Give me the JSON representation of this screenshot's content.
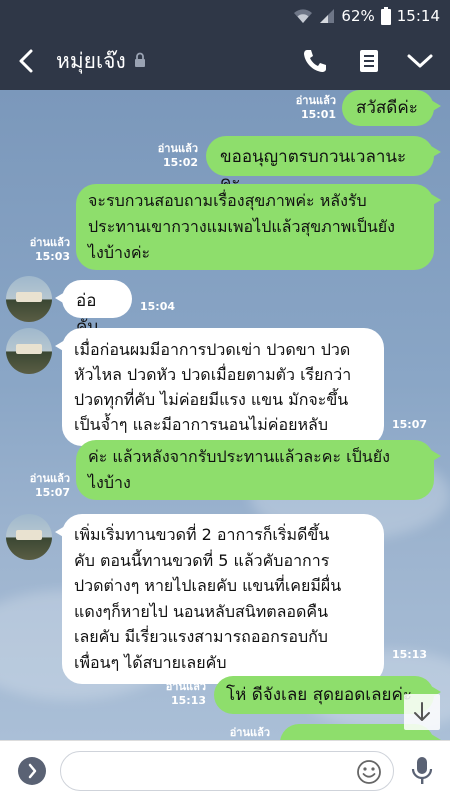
{
  "status_bar": {
    "battery": "62%",
    "time": "15:14",
    "icons": [
      "wifi-icon",
      "signal-icon",
      "battery-icon"
    ]
  },
  "header": {
    "title": "หมุ่ยเจ๊ง",
    "icons": [
      "back-icon",
      "lock-icon",
      "phone-icon",
      "notes-icon",
      "chevron-down-icon"
    ]
  },
  "messages": [
    {
      "side": "me",
      "read": "อ่านแล้ว",
      "time": "15:01",
      "text": "สวัสดีค่ะ"
    },
    {
      "side": "me",
      "read": "อ่านแล้ว",
      "time": "15:02",
      "text": "ขออนุญาตรบกวนเวลานะคะ"
    },
    {
      "side": "me",
      "read": "อ่านแล้ว",
      "time": "15:03",
      "lines": [
        "จะรบกวนสอบถามเรื่องสุขภาพค่ะ หลังรับ",
        "ประทานเขากวางแมเพอไปแล้วสุขภาพเป็นยัง",
        "ไงบ้างค่ะ"
      ]
    },
    {
      "side": "them",
      "time": "15:04",
      "text": "อ่อคับ"
    },
    {
      "side": "them",
      "time": "15:07",
      "lines": [
        "เมื่อก่อนผมมีอาการปวดเข่า ปวดขา ปวด",
        "หัวไหล ปวดหัว ปวดเมื่อยตามตัว เรียกว่า",
        "ปวดทุกที่คับ ไม่ค่อยมีแรง แขน มักจะขึ้น",
        "เป็นจ้ำๆ และมีอาการนอนไม่ค่อยหลับ"
      ]
    },
    {
      "side": "me",
      "read": "อ่านแล้ว",
      "time": "15:07",
      "lines": [
        "ค่ะ แล้วหลังจากรับประทานแล้วละคะ เป็นยัง",
        "ไงบ้าง"
      ]
    },
    {
      "side": "them",
      "time": "15:13",
      "lines": [
        "เพิ่มเริ่มทานขวดที่ 2 อาการก็เริ่มดีขึ้น",
        "คับ ตอนนี้ทานขวดที่ 5 แล้วคับอาการ",
        "ปวดต่างๆ หายไปเลยคับ แขนที่เคยมีผื่น",
        "แดงๆก็หายไป นอนหลับสนิทตลอดคืน",
        "เลยคับ มีเรี่ยวแรงสามารถออกรอบกับ",
        "เพื่อนๆ ได้สบายเลยคับ"
      ]
    },
    {
      "side": "me",
      "read": "อ่านแล้ว",
      "time": "15:13",
      "text": "โห่ ดีจังเลย สุดยอดเลยค่ะ"
    },
    {
      "side": "me",
      "read": "อ่านแล้ว",
      "text": ""
    }
  ],
  "input": {
    "value": "",
    "icons": [
      "expand-icon",
      "emoji-icon",
      "microphone-icon"
    ]
  },
  "colors": {
    "header_bg": "#2f3747",
    "my_bubble": "#8ede6c",
    "their_bubble": "#ffffff",
    "chat_bg": "#8aa6c6"
  }
}
